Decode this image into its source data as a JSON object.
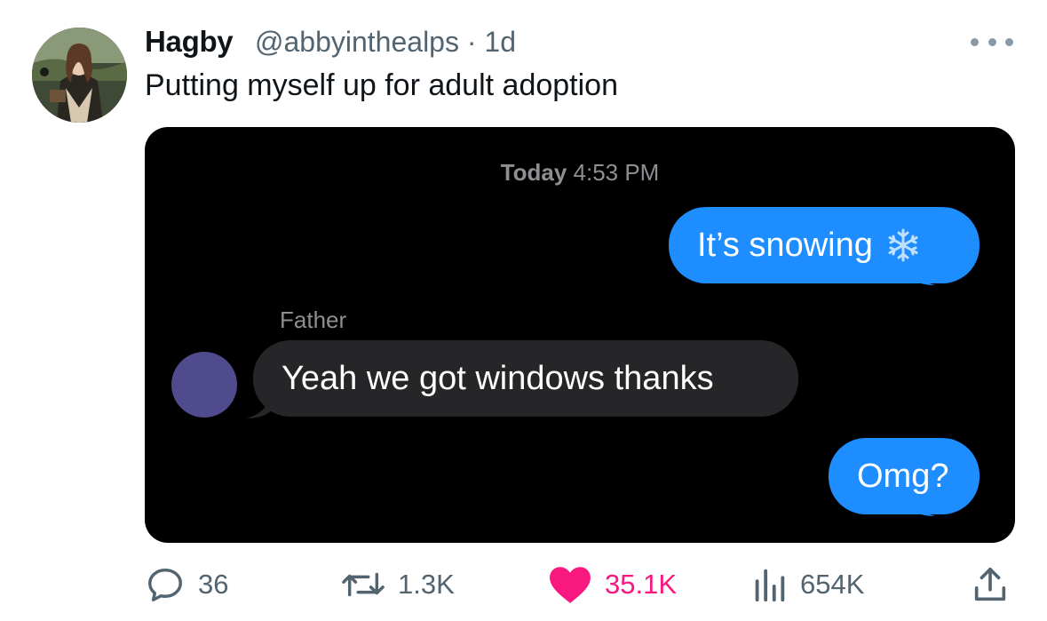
{
  "tweet": {
    "display_name": "Hagby",
    "handle": "@abbyinthealps",
    "separator": "·",
    "age": "1d",
    "text": "Putting myself up for adult adoption",
    "more_icon": "more-horizontal-icon"
  },
  "media": {
    "timestamp_day": "Today",
    "timestamp_time": "4:53 PM",
    "messages": [
      {
        "direction": "outgoing",
        "text": "It’s snowing",
        "emoji": "snowflake"
      },
      {
        "direction": "incoming",
        "sender": "Father",
        "text": "Yeah we got windows thanks"
      },
      {
        "direction": "outgoing",
        "text": "Omg?"
      }
    ],
    "colors": {
      "outgoing": "#1e8dff",
      "incoming": "#262629",
      "background": "#000000",
      "sender_avatar": "#4f4b8d"
    }
  },
  "actions": {
    "reply_count": "36",
    "retweet_count": "1.3K",
    "like_count": "35.1K",
    "view_count": "654K",
    "like_color": "#f91880"
  }
}
